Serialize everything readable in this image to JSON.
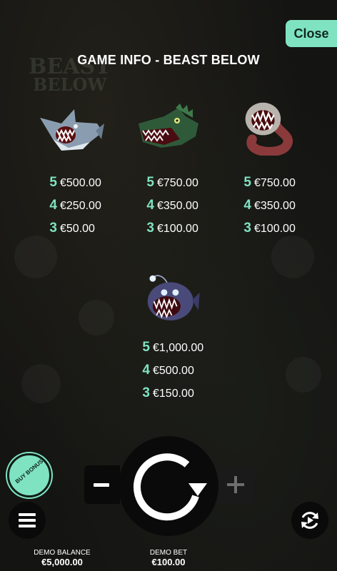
{
  "background": {
    "logo_lines": [
      "",
      "BEAST",
      "BELOW"
    ]
  },
  "close_button": {
    "label": "Close"
  },
  "title": "GAME INFO - BEAST BELOW",
  "symbols": [
    {
      "name": "shark-icon",
      "pays": [
        {
          "count": "5",
          "value": "€500.00"
        },
        {
          "count": "4",
          "value": "€250.00"
        },
        {
          "count": "3",
          "value": "€50.00"
        }
      ]
    },
    {
      "name": "crocodile-icon",
      "pays": [
        {
          "count": "5",
          "value": "€750.00"
        },
        {
          "count": "4",
          "value": "€350.00"
        },
        {
          "count": "3",
          "value": "€100.00"
        }
      ]
    },
    {
      "name": "sea-worm-icon",
      "pays": [
        {
          "count": "5",
          "value": "€750.00"
        },
        {
          "count": "4",
          "value": "€350.00"
        },
        {
          "count": "3",
          "value": "€100.00"
        }
      ]
    },
    {
      "name": "anglerfish-icon",
      "pays": [
        {
          "count": "5",
          "value": "€1,000.00"
        },
        {
          "count": "4",
          "value": "€500.00"
        },
        {
          "count": "3",
          "value": "€150.00"
        }
      ]
    }
  ],
  "controls": {
    "buy_bonus_label": "BUY BONUS",
    "balance_label": "DEMO BALANCE",
    "balance_value": "€5,000.00",
    "bet_label": "DEMO BET",
    "bet_value": "€100.00"
  },
  "colors": {
    "accent": "#7fe3c2",
    "background": "#171715"
  }
}
